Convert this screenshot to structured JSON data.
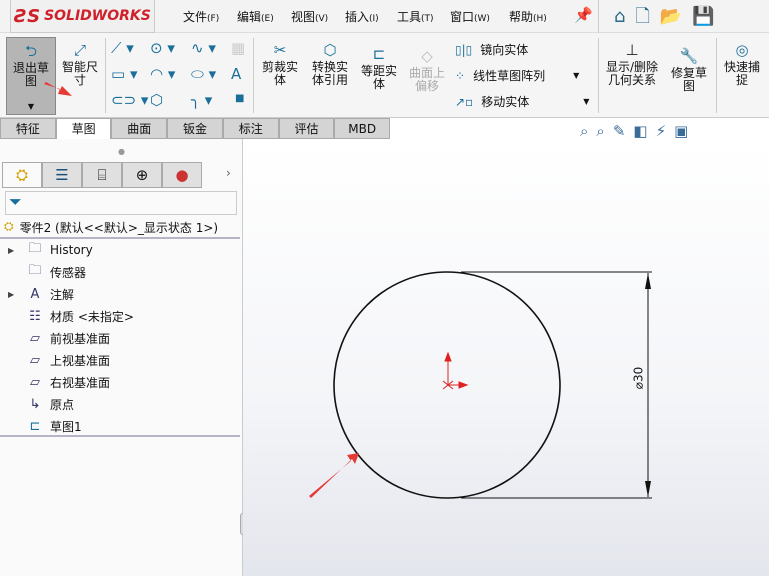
{
  "app": {
    "logo": "SOLIDWORKS"
  },
  "menu": [
    {
      "label": "文件",
      "key": "(F)"
    },
    {
      "label": "编辑",
      "key": "(E)"
    },
    {
      "label": "视图",
      "key": "(V)"
    },
    {
      "label": "插入",
      "key": "(I)"
    },
    {
      "label": "工具",
      "key": "(T)"
    },
    {
      "label": "窗口",
      "key": "(W)"
    },
    {
      "label": "帮助",
      "key": "(H)"
    }
  ],
  "ribbon": {
    "exit_sketch": "退出草图",
    "smart_dim": "智能尺寸",
    "trim": "剪裁实体",
    "convert": "转换实体引用",
    "offset": "等距实体",
    "surface_offset": "曲面上偏移",
    "mirror": "镜向实体",
    "linear_pattern": "线性草图阵列",
    "move": "移动实体",
    "relations": "显示/删除几何关系",
    "repair": "修复草图",
    "quick_snap": "快速捕捉"
  },
  "tabs": [
    "特征",
    "草图",
    "曲面",
    "钣金",
    "标注",
    "评估",
    "MBD"
  ],
  "active_tab": "草图",
  "tree": {
    "root": "零件2  (默认<<默认>_显示状态 1>)",
    "items": [
      {
        "label": "History",
        "expand": true
      },
      {
        "label": "传感器"
      },
      {
        "label": "注解",
        "expand": true
      },
      {
        "label": "材质 <未指定>"
      },
      {
        "label": "前视基准面"
      },
      {
        "label": "上视基准面"
      },
      {
        "label": "右视基准面"
      },
      {
        "label": "原点"
      },
      {
        "label": "草图1"
      }
    ]
  },
  "sketch": {
    "dimension": "⌀30",
    "accent": "#e53935"
  }
}
